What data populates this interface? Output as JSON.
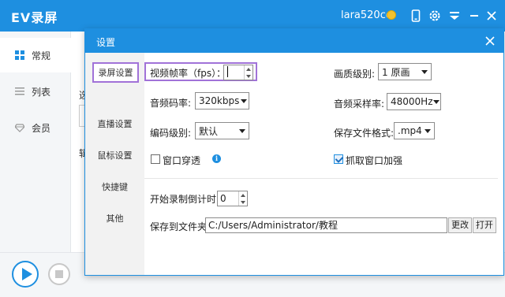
{
  "app": {
    "title": "EV录屏",
    "username": "lara520cc"
  },
  "sidebar": {
    "items": [
      {
        "label": "常规",
        "icon": "grid-icon"
      },
      {
        "label": "列表",
        "icon": "list-icon"
      },
      {
        "label": "会员",
        "icon": "diamond-icon"
      }
    ]
  },
  "behind": {
    "text1": "选",
    "text2": "辑"
  },
  "dialog": {
    "title": "设置",
    "nav": [
      "录屏设置",
      "直播设置",
      "鼠标设置",
      "快捷键",
      "其他"
    ],
    "fps_label": "视频帧率（fps）：",
    "fps_value": "",
    "quality_label": "画质级别:",
    "quality_value": "1 原画",
    "audio_bitrate_label": "音频码率:",
    "audio_bitrate_value": "320kbps",
    "sample_rate_label": "音频采样率:",
    "sample_rate_value": "48000Hz",
    "codec_label": "编码级别:",
    "codec_value": "默认",
    "format_label": "保存文件格式:",
    "format_value": ".mp4",
    "window_through_label": "窗口穿透",
    "window_through_checked": false,
    "capture_enhance_label": "抓取窗口加强",
    "capture_enhance_checked": true,
    "countdown_label": "开始录制倒计时:",
    "countdown_value": "0",
    "save_folder_label": "保存到文件夹:",
    "save_folder_value": "C:/Users/Administrator/教程",
    "change_button": "更改",
    "open_button": "打开"
  }
}
